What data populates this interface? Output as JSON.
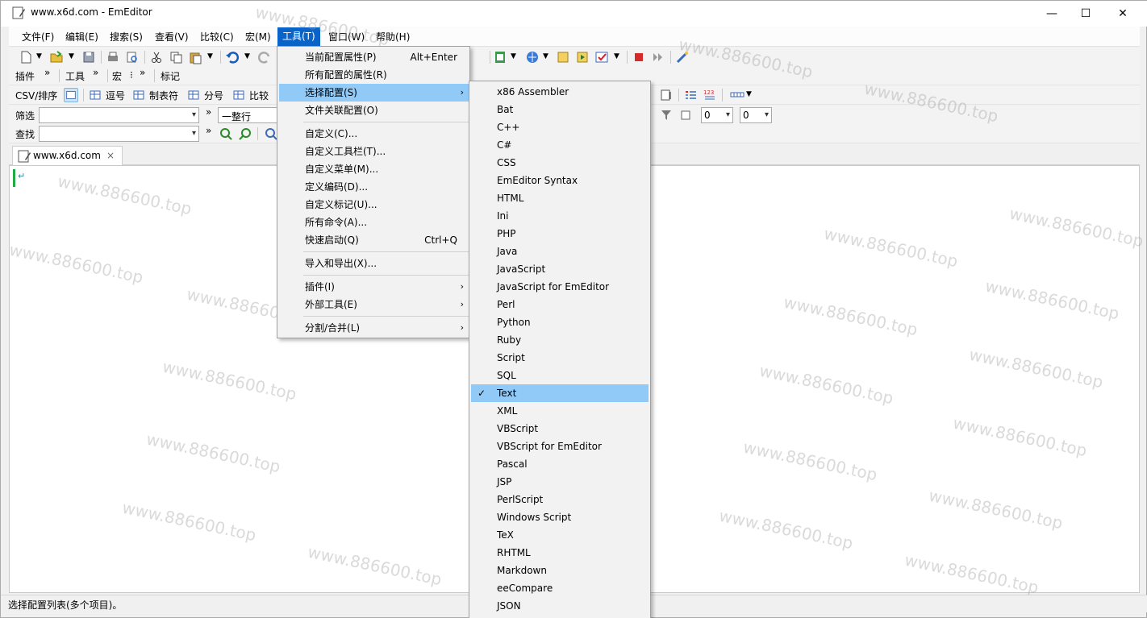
{
  "window": {
    "title": "www.x6d.com - EmEditor",
    "min": "—",
    "max": "☐",
    "close": "✕"
  },
  "menubar": [
    "文件(F)",
    "编辑(E)",
    "搜索(S)",
    "查看(V)",
    "比较(C)",
    "宏(M)",
    "工具(T)",
    "窗口(W)",
    "帮助(H)"
  ],
  "toolbars": {
    "row2": {
      "plugin": "插件",
      "tools": "工具",
      "macro": "宏",
      "marker": "标记"
    },
    "csv": {
      "label": "CSV/排序",
      "comma": "逗号",
      "tab": "制表符",
      "semicolon": "分号",
      "compare": "比较"
    },
    "filter": {
      "label": "筛选",
      "scope": "一整行",
      "num1": "0",
      "num2": "0"
    },
    "find": {
      "label": "查找"
    }
  },
  "tab": {
    "title": "www.x6d.com",
    "close": "×"
  },
  "editor": {
    "newline_mark": "↵"
  },
  "tools_menu": {
    "items": [
      {
        "label": "当前配置属性(P)",
        "shortcut": "Alt+Enter"
      },
      {
        "label": "所有配置的属性(R)"
      },
      {
        "label": "选择配置(S)",
        "submenu": true
      },
      {
        "label": "文件关联配置(O)"
      },
      {
        "label": "自定义(C)..."
      },
      {
        "label": "自定义工具栏(T)..."
      },
      {
        "label": "自定义菜单(M)..."
      },
      {
        "label": "定义编码(D)..."
      },
      {
        "label": "自定义标记(U)..."
      },
      {
        "label": "所有命令(A)..."
      },
      {
        "label": "快速启动(Q)",
        "shortcut": "Ctrl+Q"
      },
      {
        "label": "导入和导出(X)..."
      },
      {
        "label": "插件(I)",
        "submenu": true
      },
      {
        "label": "外部工具(E)",
        "submenu": true
      },
      {
        "label": "分割/合并(L)",
        "submenu": true
      }
    ]
  },
  "config_menu": {
    "items": [
      "x86 Assembler",
      "Bat",
      "C++",
      "C#",
      "CSS",
      "EmEditor Syntax",
      "HTML",
      "Ini",
      "PHP",
      "Java",
      "JavaScript",
      "JavaScript for EmEditor",
      "Perl",
      "Python",
      "Ruby",
      "Script",
      "SQL",
      "Text",
      "XML",
      "VBScript",
      "VBScript for EmEditor",
      "Pascal",
      "JSP",
      "PerlScript",
      "Windows Script",
      "TeX",
      "RHTML",
      "Markdown",
      "eeCompare",
      "JSON"
    ],
    "selected": "Text",
    "check": "✓"
  },
  "status": {
    "text": "选择配置列表(多个项目)。"
  },
  "watermark": "www.886600.top",
  "colors": {
    "highlight": "#91c9f7",
    "menu_active": "#0a64c8",
    "menu_bg": "#f2f2f2"
  }
}
